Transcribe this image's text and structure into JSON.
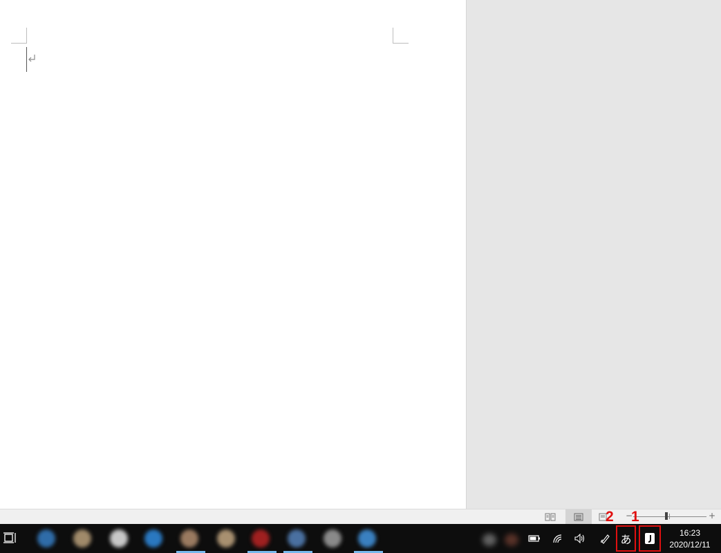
{
  "colors": {
    "accent": "#76b9ed",
    "annotation": "#e01010",
    "taskbar": "#0d0d0d",
    "canvas": "#e6e6e6"
  },
  "document": {
    "icons": [
      "paragraph-mark-icon"
    ]
  },
  "status_bar": {
    "views": [
      "read-mode-icon",
      "print-layout-icon",
      "web-layout-icon"
    ],
    "zoom_minus": "−",
    "zoom_plus": "+"
  },
  "taskbar": {
    "apps": [
      {
        "name": "app-1",
        "color": "#2f6ca8",
        "active": false
      },
      {
        "name": "app-2",
        "color": "#a08a6a",
        "active": false
      },
      {
        "name": "app-3",
        "color": "#c8c8c8",
        "active": false
      },
      {
        "name": "app-4",
        "color": "#2a78c0",
        "active": false
      },
      {
        "name": "app-5",
        "color": "#9a7a60",
        "active": true
      },
      {
        "name": "app-6",
        "color": "#a89070",
        "active": false
      },
      {
        "name": "app-7",
        "color": "#a02020",
        "active": true
      },
      {
        "name": "app-8",
        "color": "#4a70a0",
        "active": true
      },
      {
        "name": "app-9",
        "color": "#8a8a8a",
        "active": false
      },
      {
        "name": "app-10",
        "color": "#3a80c0",
        "active": true
      }
    ],
    "tray": {
      "icons": [
        "battery-icon",
        "wifi-icon",
        "speaker-icon",
        "pen-icon"
      ],
      "ime_mode": "あ",
      "time": "16:23",
      "date": "2020/12/11"
    },
    "annotations": [
      "2",
      "1"
    ]
  }
}
